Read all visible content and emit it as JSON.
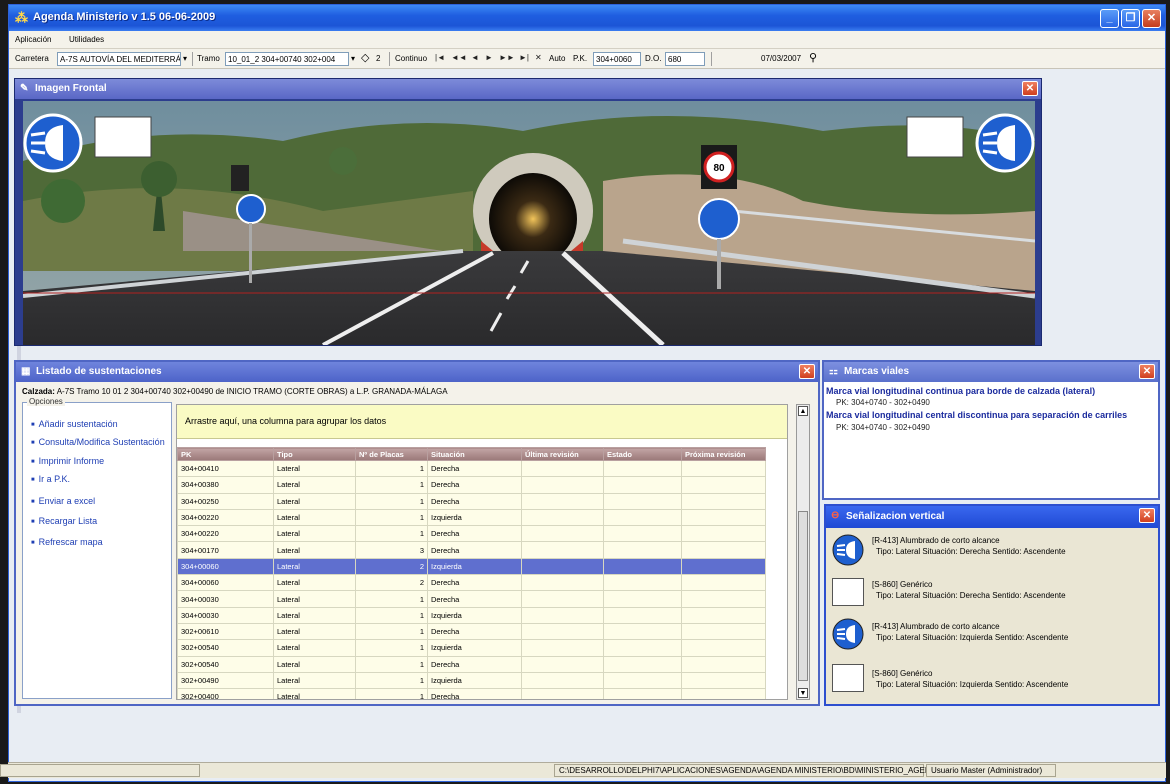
{
  "window": {
    "title": "Agenda Ministerio v 1.5 06-06-2009",
    "minimize": "_",
    "restore": "❐",
    "close": "✕"
  },
  "menu": {
    "items": [
      "Aplicación",
      "Utilidades"
    ]
  },
  "toolbar": {
    "carretera_label": "Carretera",
    "carretera_value": "A-7S AUTOVÍA DEL MEDITERRÁ",
    "tramo_label": "Tramo",
    "tramo_value": "10_01_2  304+00740  302+004",
    "tramo_count": "2",
    "continuo_label": "Continuo",
    "nav": [
      "|◄",
      "◄◄",
      "◄",
      "►",
      "►►",
      "►|",
      "✕"
    ],
    "auto_label": "Auto",
    "pk_label": "P.K.",
    "pk_value": "304+0060",
    "do_label": "D.O.",
    "do_value": "680",
    "date_value": "07/03/2007"
  },
  "frontal": {
    "title": "Imagen Frontal",
    "close": "✕"
  },
  "listado": {
    "title": "Listado de sustentaciones",
    "close": "✕",
    "calzada_label": "Calzada:",
    "calzada_text": "A-7S Tramo 10  01  2  304+00740  302+00490 de INICIO TRAMO (CORTE OBRAS) a L.P. GRANADA-MÁLAGA",
    "opciones_label": "Opciones",
    "opciones": [
      "Añadir sustentación",
      "Consulta/Modifica Sustentación",
      "Imprimir Informe",
      "Ir a P.K.",
      "Enviar a excel",
      "Recargar Lista",
      "Refrescar mapa"
    ],
    "group_hint": "Arrastre aquí, una columna para agrupar los datos",
    "columns": [
      "PK",
      "Tipo",
      "Nº de Placas",
      "Situación",
      "Última revisión",
      "Estado",
      "Próxima revisión"
    ],
    "rows": [
      [
        "304+00410",
        "Lateral",
        "1",
        "Derecha"
      ],
      [
        "304+00380",
        "Lateral",
        "1",
        "Derecha"
      ],
      [
        "304+00250",
        "Lateral",
        "1",
        "Derecha"
      ],
      [
        "304+00220",
        "Lateral",
        "1",
        "Izquierda"
      ],
      [
        "304+00220",
        "Lateral",
        "1",
        "Derecha"
      ],
      [
        "304+00170",
        "Lateral",
        "3",
        "Derecha"
      ],
      [
        "304+00060",
        "Lateral",
        "2",
        "Izquierda"
      ],
      [
        "304+00060",
        "Lateral",
        "2",
        "Derecha"
      ],
      [
        "304+00030",
        "Lateral",
        "1",
        "Derecha"
      ],
      [
        "304+00030",
        "Lateral",
        "1",
        "Izquierda"
      ],
      [
        "302+00610",
        "Lateral",
        "1",
        "Derecha"
      ],
      [
        "302+00540",
        "Lateral",
        "1",
        "Izquierda"
      ],
      [
        "302+00540",
        "Lateral",
        "1",
        "Derecha"
      ],
      [
        "302+00490",
        "Lateral",
        "1",
        "Izquierda"
      ],
      [
        "302+00400",
        "Lateral",
        "1",
        "Derecha"
      ]
    ],
    "selected_row": 6
  },
  "marcas": {
    "title": "Marcas viales",
    "close": "✕",
    "items": [
      {
        "title": "Marca vial longitudinal continua para borde de calzada (lateral)",
        "pk": "PK: 304+0740 - 302+0490"
      },
      {
        "title": "Marca vial longitudinal central discontinua para separación de carriles",
        "pk": "PK: 304+0740 - 302+0490"
      }
    ]
  },
  "senal": {
    "title": "Señalizacion vertical",
    "close": "✕",
    "items": [
      {
        "icon": "light-sign-icon",
        "name": "[R-413] Alumbrado de corto alcance",
        "detail": "Tipo: Lateral  Situación: Derecha  Sentido: Ascendente"
      },
      {
        "icon": "blank-sign-icon",
        "name": "[S-860] Genérico",
        "detail": "Tipo: Lateral  Situación: Derecha  Sentido: Ascendente"
      },
      {
        "icon": "light-sign-icon",
        "name": "[R-413] Alumbrado de corto alcance",
        "detail": "Tipo: Lateral  Situación: Izquierda  Sentido: Ascendente"
      },
      {
        "icon": "blank-sign-icon",
        "name": "[S-860] Genérico",
        "detail": "Tipo: Lateral  Situación: Izquierda  Sentido: Ascendente"
      }
    ]
  },
  "status": {
    "path": "C:\\DESARROLLO\\DELPHI7\\APLICACIONES\\AGENDA\\AGENDA MINISTERIO\\BD\\MINISTERIO_AGENDA.MDB",
    "user": "Usuario Master (Administrador)"
  },
  "colors": {
    "title_blue": "#1f5ee0",
    "panel_blue": "#4f66c4",
    "selected_row": "#5f6fcf",
    "close_red": "#d04020"
  }
}
